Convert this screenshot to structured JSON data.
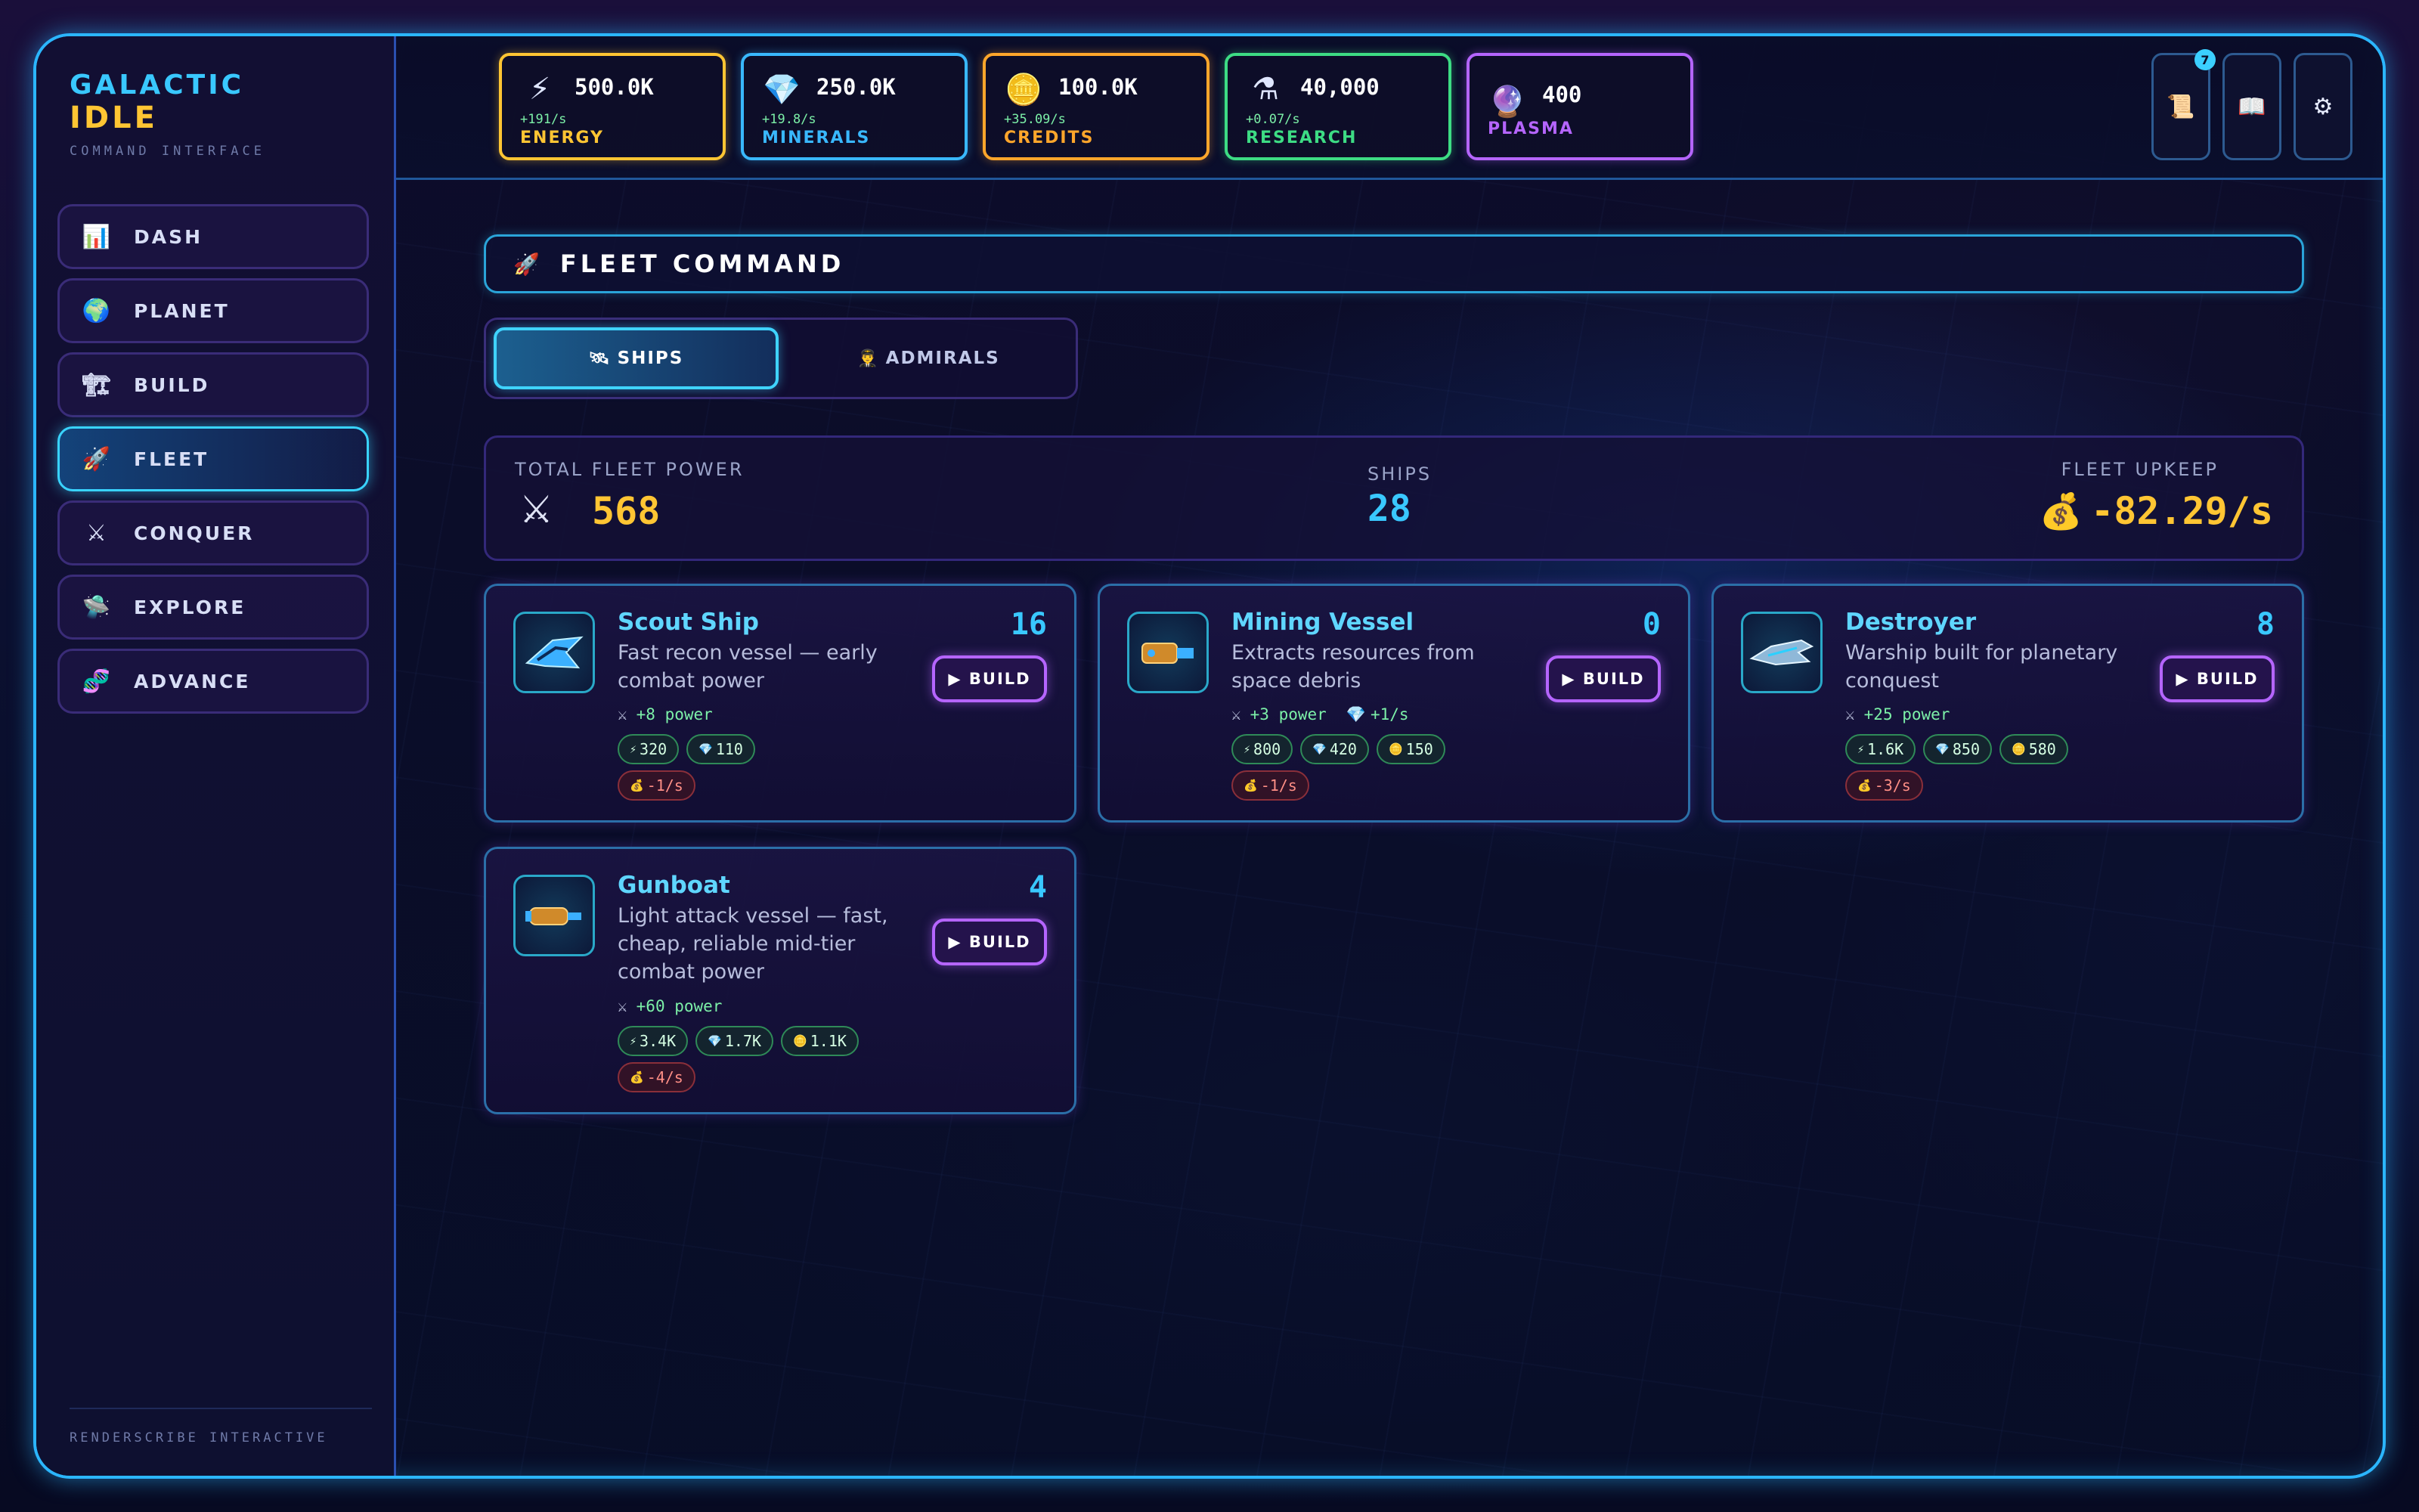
{
  "app": {
    "logo_line1": "GALACTIC",
    "logo_line2": "IDLE",
    "logo_sub": "COMMAND INTERFACE",
    "footer": "RENDERSCRIBE INTERACTIVE"
  },
  "nav": [
    {
      "label": "DASH",
      "icon": "bar-chart-icon",
      "glyph": "📊"
    },
    {
      "label": "PLANET",
      "icon": "globe-icon",
      "glyph": "🌍"
    },
    {
      "label": "BUILD",
      "icon": "crane-icon",
      "glyph": "🏗"
    },
    {
      "label": "FLEET",
      "icon": "rocket-icon",
      "glyph": "🚀"
    },
    {
      "label": "CONQUER",
      "icon": "crossed-swords-icon",
      "glyph": "⚔"
    },
    {
      "label": "EXPLORE",
      "icon": "ufo-icon",
      "glyph": "🛸"
    },
    {
      "label": "ADVANCE",
      "icon": "dna-icon",
      "glyph": "🧬"
    }
  ],
  "resources": [
    {
      "name": "ENERGY",
      "value": "500.0K",
      "rate": "+191/s",
      "color": "#ffc533",
      "icon": "lightning-icon",
      "glyph": "⚡"
    },
    {
      "name": "MINERALS",
      "value": "250.0K",
      "rate": "+19.8/s",
      "color": "#39b8ff",
      "icon": "crystal-icon",
      "glyph": "💎"
    },
    {
      "name": "CREDITS",
      "value": "100.0K",
      "rate": "+35.09/s",
      "color": "#ffa62b",
      "icon": "coin-icon",
      "glyph": "🪙"
    },
    {
      "name": "RESEARCH",
      "value": "40,000",
      "rate": "+0.07/s",
      "color": "#3ddc84",
      "icon": "flask-icon",
      "glyph": "⚗"
    },
    {
      "name": "PLASMA",
      "value": "400",
      "rate": "",
      "color": "#b565ff",
      "icon": "plasma-orb-icon",
      "glyph": "🔮"
    }
  ],
  "top_buttons": [
    {
      "icon": "scroll-icon",
      "glyph": "📜",
      "badge": "7"
    },
    {
      "icon": "book-icon",
      "glyph": "📖",
      "badge": ""
    },
    {
      "icon": "gear-icon",
      "glyph": "⚙",
      "badge": ""
    }
  ],
  "panel": {
    "title": "FLEET COMMAND",
    "tabs": [
      "SHIPS",
      "ADMIRALS"
    ]
  },
  "summary": {
    "power_label": "TOTAL FLEET POWER",
    "power_value": "568",
    "ships_label": "SHIPS",
    "ships_value": "28",
    "upkeep_label": "FLEET UPKEEP",
    "upkeep_value": "-82.29/s"
  },
  "ships": [
    {
      "name": "Scout Ship",
      "desc": "Fast recon vessel — early combat power",
      "count": "16",
      "power": "+8 power",
      "extra": "",
      "costs": [
        {
          "type": "energy",
          "value": "320"
        },
        {
          "type": "minerals",
          "value": "110"
        }
      ],
      "upkeep": "-1/s"
    },
    {
      "name": "Mining Vessel",
      "desc": "Extracts resources from space debris",
      "count": "0",
      "power": "+3 power",
      "extra": "+1/s",
      "costs": [
        {
          "type": "energy",
          "value": "800"
        },
        {
          "type": "minerals",
          "value": "420"
        },
        {
          "type": "credits",
          "value": "150"
        }
      ],
      "upkeep": "-1/s"
    },
    {
      "name": "Destroyer",
      "desc": "Warship built for planetary conquest",
      "count": "8",
      "power": "+25 power",
      "extra": "",
      "costs": [
        {
          "type": "energy",
          "value": "1.6K"
        },
        {
          "type": "minerals",
          "value": "850"
        },
        {
          "type": "credits",
          "value": "580"
        }
      ],
      "upkeep": "-3/s"
    },
    {
      "name": "Gunboat",
      "desc": "Light attack vessel — fast, cheap, reliable mid-tier combat power",
      "count": "4",
      "power": "+60 power",
      "extra": "",
      "costs": [
        {
          "type": "energy",
          "value": "3.4K"
        },
        {
          "type": "minerals",
          "value": "1.7K"
        },
        {
          "type": "credits",
          "value": "1.1K"
        }
      ],
      "upkeep": "-4/s"
    }
  ],
  "build_label": "▶ BUILD"
}
